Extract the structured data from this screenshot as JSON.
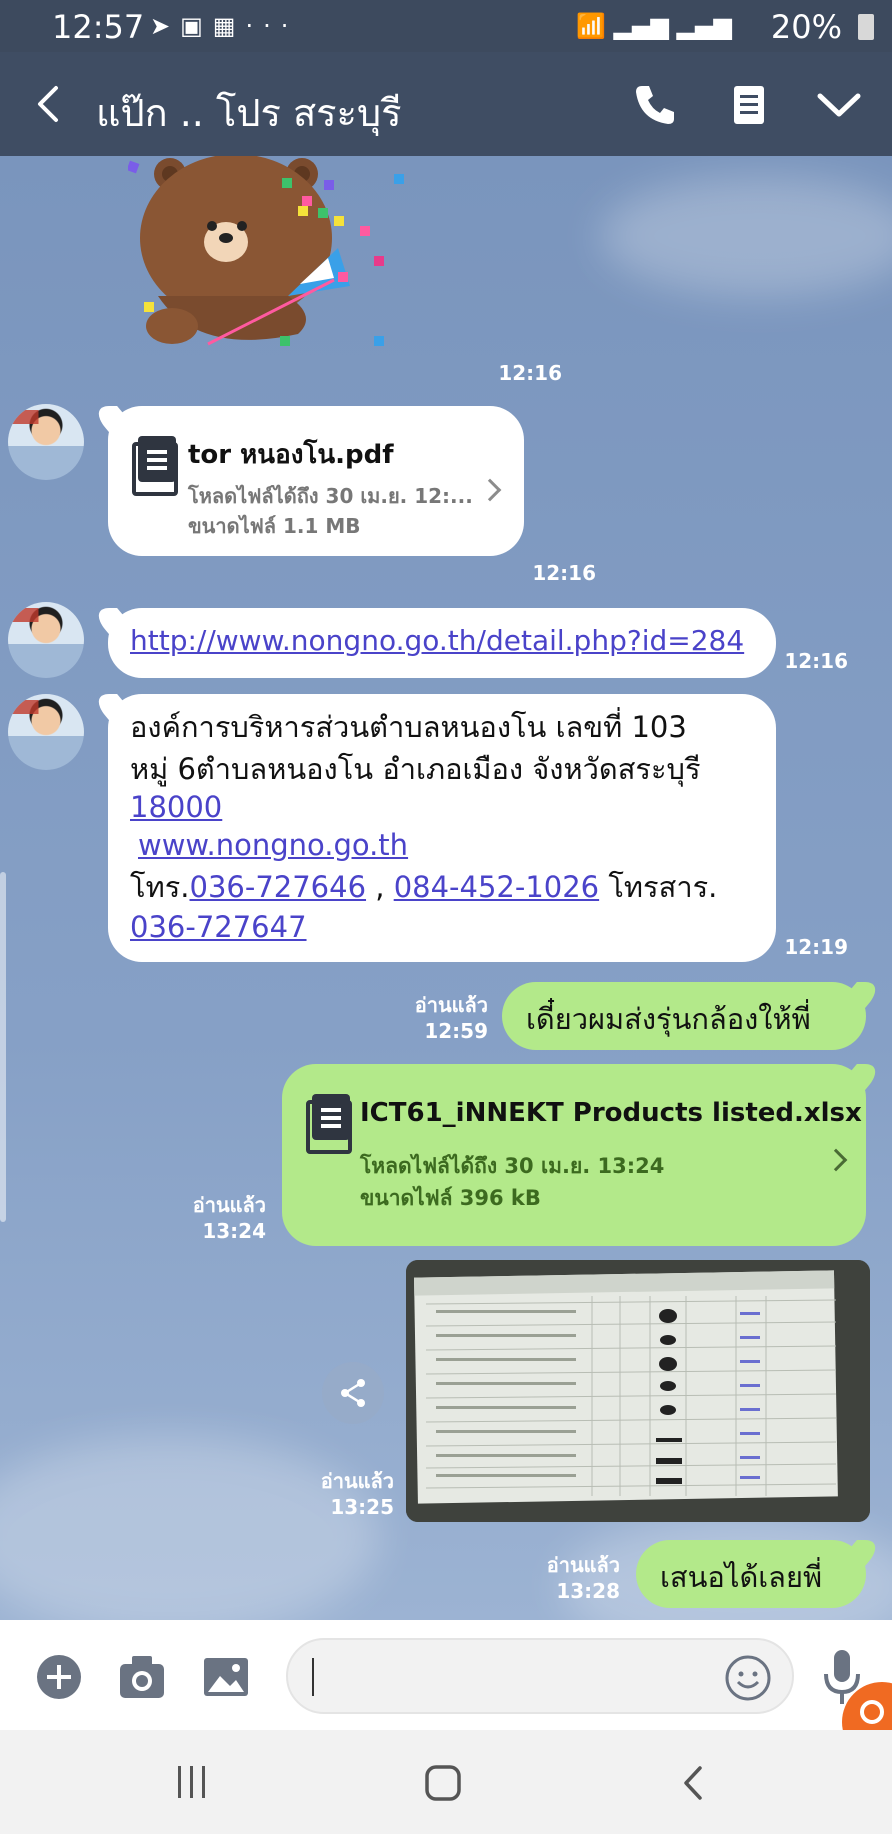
{
  "status": {
    "time": "12:57",
    "icons": [
      "send-icon",
      "image-icon",
      "gift-icon",
      "more-dots-icon"
    ],
    "battery": "20%"
  },
  "header": {
    "title": "แป๊ก .. โปร สระบุรี",
    "icons": [
      "back-icon",
      "phone-icon",
      "notes-icon",
      "chevron-down-icon"
    ]
  },
  "messages": {
    "sticker_time": "12:16",
    "file1": {
      "name": "tor หนองโน.pdf",
      "download_until": "โหลดไฟล์ได้ถึง 30 เม.ย. 12:...",
      "size": "ขนาดไฟล์ 1.1 MB",
      "time": "12:16"
    },
    "link1": {
      "text": "http://www.nongno.go.th/detail.php?id=284",
      "time": "12:16"
    },
    "address": {
      "line1": "องค์การบริหารส่วนตำบลหนองโน เลขที่ 103",
      "line2": "หมู่ 6ตำบลหนองโน อำเภอเมือง จังหวัดสระบุรี",
      "postcode": "18000",
      "website": "www.nongno.go.th",
      "tel_label": "โทร.",
      "tel1": "036-727646",
      "sep": ",",
      "tel2": "084-452-1026",
      "fax_label": "โทรสาร.",
      "fax": "036-727647",
      "time": "12:19"
    },
    "out1": {
      "text": "เดี๋ยวผมส่งรุ่นกล้องให้พี่",
      "read": "อ่านแล้ว",
      "time": "12:59"
    },
    "file2": {
      "name": "ICT61_iNNEKT Products listed.xlsx",
      "download_until": "โหลดไฟล์ได้ถึง 30 เม.ย. 13:24",
      "size": "ขนาดไฟล์ 396 kB",
      "read": "อ่านแล้ว",
      "time": "13:24"
    },
    "photo": {
      "read": "อ่านแล้ว",
      "time": "13:25"
    },
    "out2": {
      "text": "เสนอได้เลยพี่",
      "read": "อ่านแล้ว",
      "time": "13:28"
    }
  },
  "inputbar": {
    "icons": [
      "add-icon",
      "camera-icon",
      "gallery-icon",
      "emoji-icon",
      "mic-icon"
    ],
    "value": ""
  },
  "navbar": {
    "icons": [
      "recents-icon",
      "home-icon",
      "nav-back-icon"
    ]
  }
}
